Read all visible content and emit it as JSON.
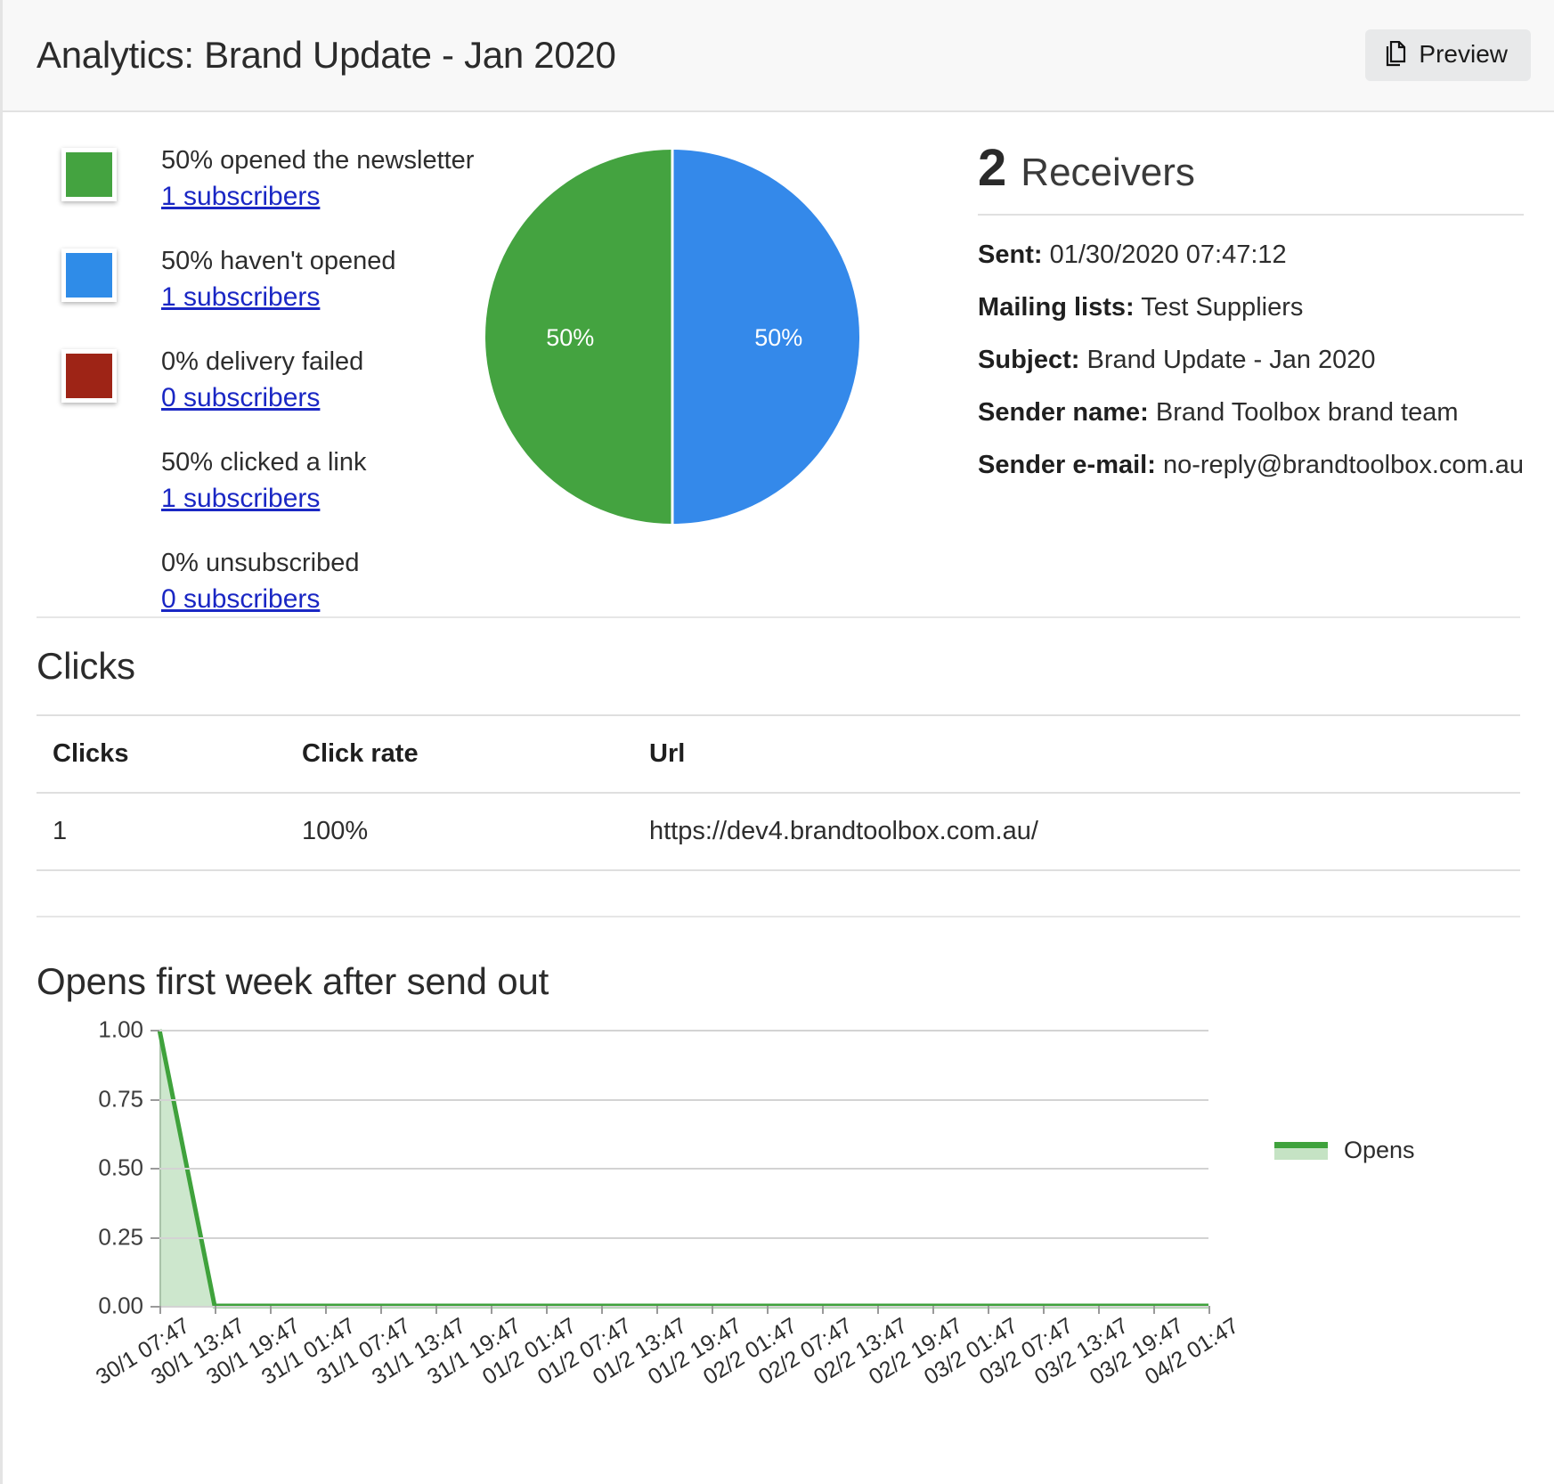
{
  "header": {
    "title": "Analytics: Brand Update - Jan 2020",
    "preview_label": "Preview",
    "preview_icon": "copy-files-icon"
  },
  "stats": {
    "items": [
      {
        "label": "50% opened the newsletter",
        "link": "1 subscribers",
        "color": "#44a340",
        "has_swatch": true
      },
      {
        "label": "50% haven't opened",
        "link": "1 subscribers",
        "color": "#2f8ce8",
        "has_swatch": true
      },
      {
        "label": "0% delivery failed",
        "link": "0 subscribers",
        "color": "#9e2416",
        "has_swatch": true
      },
      {
        "label": "50% clicked a link",
        "link": "1 subscribers",
        "color": "",
        "has_swatch": false
      },
      {
        "label": "0% unsubscribed",
        "link": "0 subscribers",
        "color": "",
        "has_swatch": false
      }
    ]
  },
  "pie": {
    "left_pct": "50%",
    "right_pct": "50%",
    "left_color": "#44a340",
    "right_color": "#3489ea"
  },
  "receivers": {
    "count": "2",
    "word": "Receivers",
    "details": [
      {
        "key": "Sent:",
        "value": "01/30/2020 07:47:12"
      },
      {
        "key": "Mailing lists:",
        "value": "Test Suppliers"
      },
      {
        "key": "Subject:",
        "value": "Brand Update - Jan 2020"
      },
      {
        "key": "Sender name:",
        "value": "Brand Toolbox brand team"
      },
      {
        "key": "Sender e-mail:",
        "value": "no-reply@brandtoolbox.com.au"
      }
    ]
  },
  "clicks": {
    "heading": "Clicks",
    "columns": [
      "Clicks",
      "Click rate",
      "Url"
    ],
    "rows": [
      {
        "clicks": "1",
        "rate": "100%",
        "url": "https://dev4.brandtoolbox.com.au/"
      }
    ]
  },
  "opens_chart": {
    "heading": "Opens first week after send out"
  },
  "chart_data": {
    "type": "line",
    "title": "Opens first week after send out",
    "xlabel": "",
    "ylabel": "",
    "ylim": [
      0,
      1.0
    ],
    "yticks": [
      "0.00",
      "0.25",
      "0.50",
      "0.75",
      "1.00"
    ],
    "grid": true,
    "legend_position": "right",
    "legend": [
      "Opens"
    ],
    "line_color": "#3fa23c",
    "fill_color": "#3fa23c",
    "x": [
      "30/1 07:47",
      "30/1 13:47",
      "30/1 19:47",
      "31/1 01:47",
      "31/1 07:47",
      "31/1 13:47",
      "31/1 19:47",
      "01/2 01:47",
      "01/2 07:47",
      "01/2 13:47",
      "01/2 19:47",
      "02/2 01:47",
      "02/2 07:47",
      "02/2 13:47",
      "02/2 19:47",
      "03/2 01:47",
      "03/2 07:47",
      "03/2 13:47",
      "03/2 19:47",
      "04/2 01:47"
    ],
    "series": [
      {
        "name": "Opens",
        "values": [
          1,
          0,
          0,
          0,
          0,
          0,
          0,
          0,
          0,
          0,
          0,
          0,
          0,
          0,
          0,
          0,
          0,
          0,
          0,
          0
        ]
      }
    ]
  }
}
